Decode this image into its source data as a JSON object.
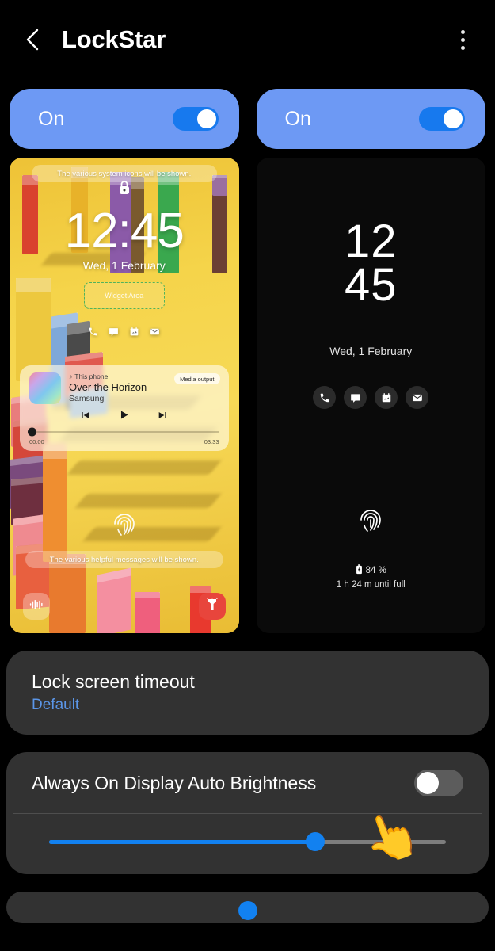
{
  "header": {
    "title": "LockStar",
    "back_icon": "chevron-left-icon",
    "menu_icon": "overflow-menu-icon"
  },
  "toggles": [
    {
      "label": "On",
      "state": "on"
    },
    {
      "label": "On",
      "state": "on"
    }
  ],
  "lock_preview": {
    "system_banner": "The various system icons will be shown.",
    "lock_icon": "lock-icon",
    "clock": "12:45",
    "date": "Wed, 1 February",
    "widget_area_label": "Widget Area",
    "notification_icons": [
      "phone-icon",
      "message-icon",
      "calendar-icon",
      "mail-icon"
    ],
    "media": {
      "source": "This phone",
      "source_icon": "music-note-icon",
      "title": "Over the Horizon",
      "artist": "Samsung",
      "output_label": "Media output",
      "prev_icon": "skip-previous-icon",
      "play_icon": "play-icon",
      "next_icon": "skip-next-icon",
      "elapsed": "00:00",
      "duration": "03:33"
    },
    "fingerprint_icon": "fingerprint-icon",
    "help_banner": "The various helpful messages will be shown.",
    "shortcut_left_icon": "voice-recorder-icon",
    "shortcut_right_icon": "flashlight-icon"
  },
  "aod_preview": {
    "clock_hour": "12",
    "clock_minute": "45",
    "date": "Wed, 1 February",
    "icons": [
      "phone-icon",
      "message-icon",
      "calendar-icon",
      "mail-icon"
    ],
    "fingerprint_icon": "fingerprint-icon",
    "battery_icon": "battery-charging-icon",
    "battery_percent": "84 %",
    "battery_until_full": "1 h 24 m until full"
  },
  "settings": {
    "lock_timeout": {
      "title": "Lock screen timeout",
      "value": "Default"
    },
    "aod_auto_brightness": {
      "title": "Always On Display Auto Brightness",
      "toggle_state": "off",
      "slider_percent": 67
    }
  },
  "cursor": {
    "icon": "pointing-hand-emoji",
    "glyph": "👆"
  },
  "colors": {
    "background": "#000000",
    "card": "#323232",
    "accent_blue": "#1281f0",
    "toggle_card_blue": "#6d99f4",
    "toggle_on_track": "#1779ee",
    "toggle_off_track": "#5c5c5c",
    "link_blue": "#5b96e8"
  }
}
